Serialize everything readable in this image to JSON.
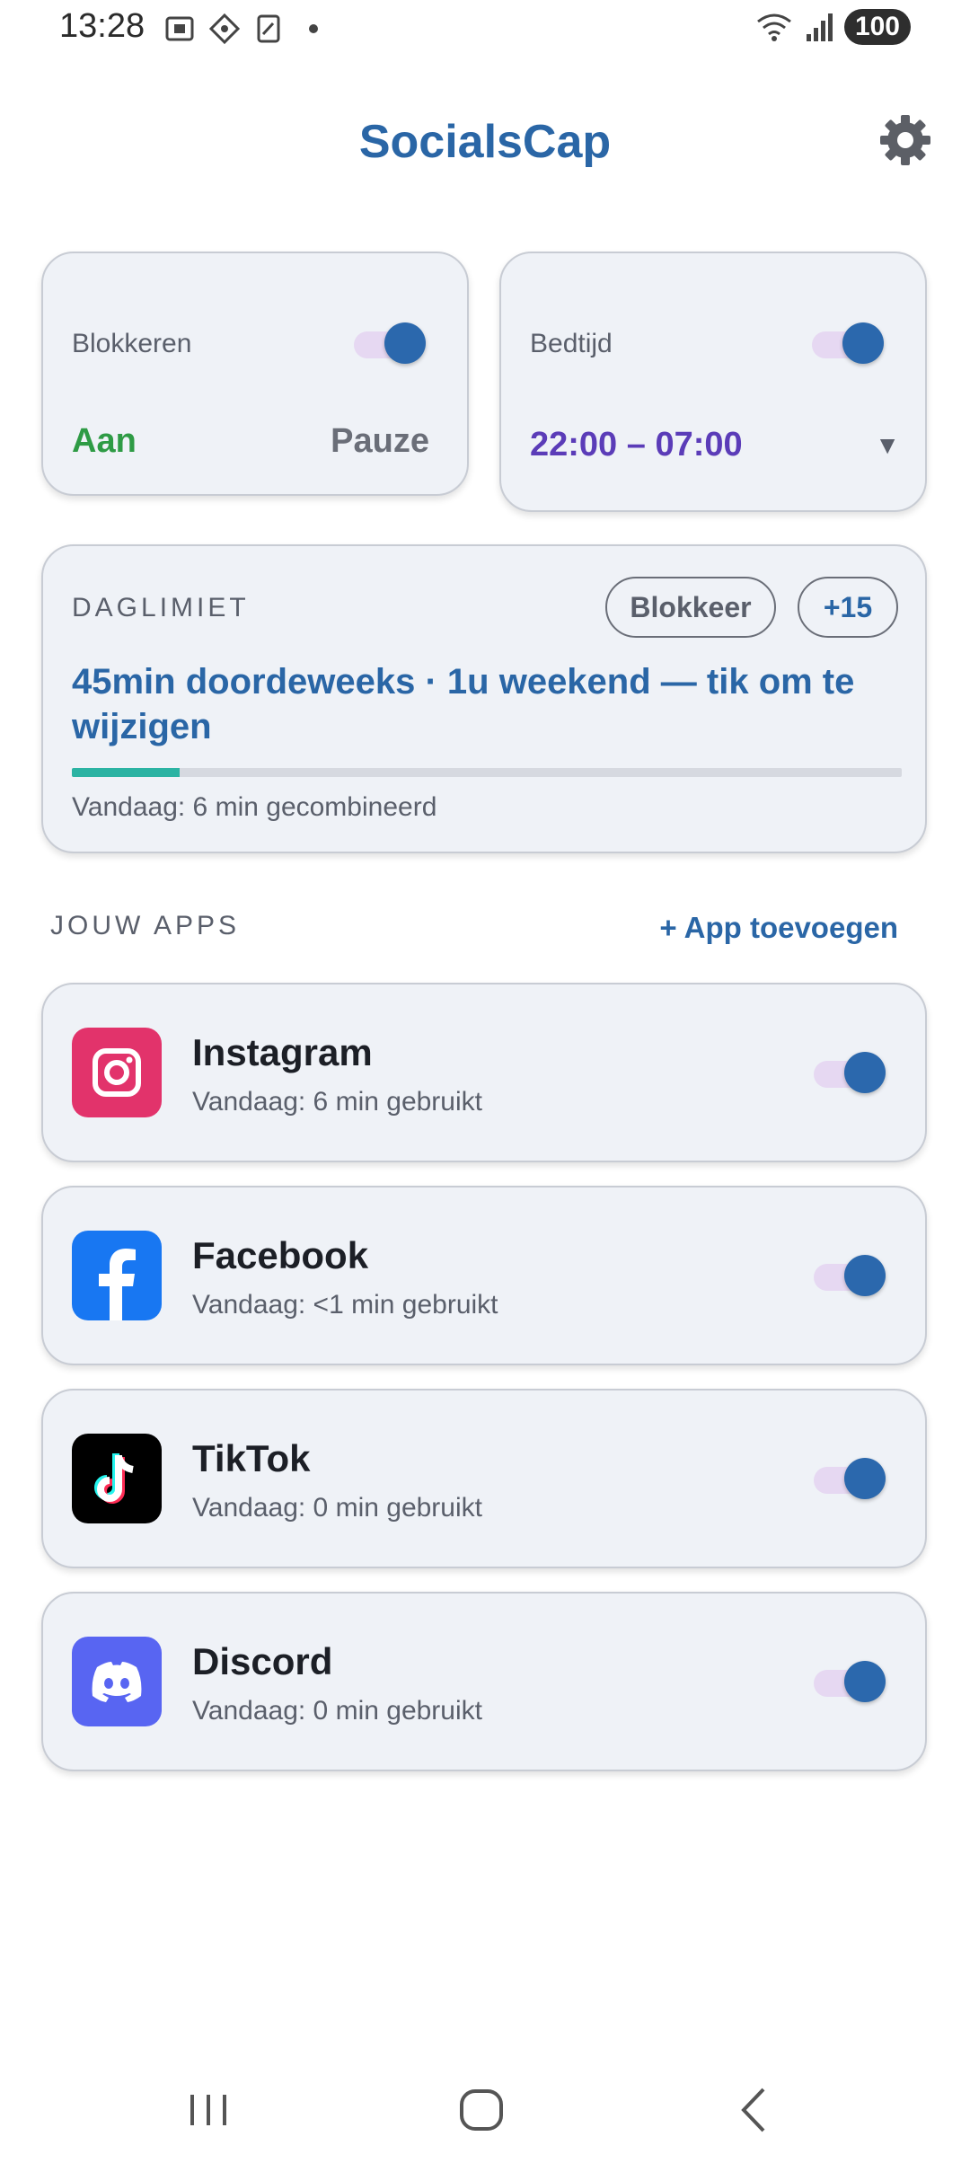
{
  "status_bar": {
    "time": "13:28",
    "battery": "100",
    "icons": [
      "screenshot-icon",
      "gesture-icon",
      "nfc-icon",
      "dot-icon",
      "wifi-icon",
      "signal-icon"
    ]
  },
  "header": {
    "title": "SocialsCap",
    "settings_icon": "gear-icon"
  },
  "block_card": {
    "label": "Blokkeren",
    "on_label": "Aan",
    "pause_label": "Pauze",
    "toggle_on": true
  },
  "bedtime_card": {
    "label": "Bedtijd",
    "time_range": "22:00 – 07:00",
    "dropdown_arrow": "▼",
    "toggle_on": true
  },
  "daily_limit": {
    "section_label": "DAGLIMIET",
    "chip_block": "Blokkeer",
    "chip_plus": "+15",
    "description": "45min doordeweeks · 1u weekend — tik om te wijzigen",
    "progress_fraction": 0.13,
    "today_label": "Vandaag: 6 min gecombineerd"
  },
  "apps_section": {
    "label": "JOUW APPS",
    "add_button": "+ App toevoegen",
    "apps": [
      {
        "name": "Instagram",
        "usage": "Vandaag: 6 min gebruikt",
        "icon": "instagram-icon",
        "color": "#e1306c",
        "enabled": true
      },
      {
        "name": "Facebook",
        "usage": "Vandaag: <1 min gebruikt",
        "icon": "facebook-icon",
        "color": "#1877f2",
        "enabled": true
      },
      {
        "name": "TikTok",
        "usage": "Vandaag: 0 min gebruikt",
        "icon": "tiktok-icon",
        "color": "#000000",
        "enabled": true
      },
      {
        "name": "Discord",
        "usage": "Vandaag: 0 min gebruikt",
        "icon": "discord-icon",
        "color": "#5865f2",
        "enabled": true
      }
    ]
  },
  "colors": {
    "primary": "#2a66a6",
    "green": "#2e9b45",
    "purple": "#5b3cb8",
    "progress": "#2bb3a3",
    "card_bg": "#eff2f7"
  }
}
